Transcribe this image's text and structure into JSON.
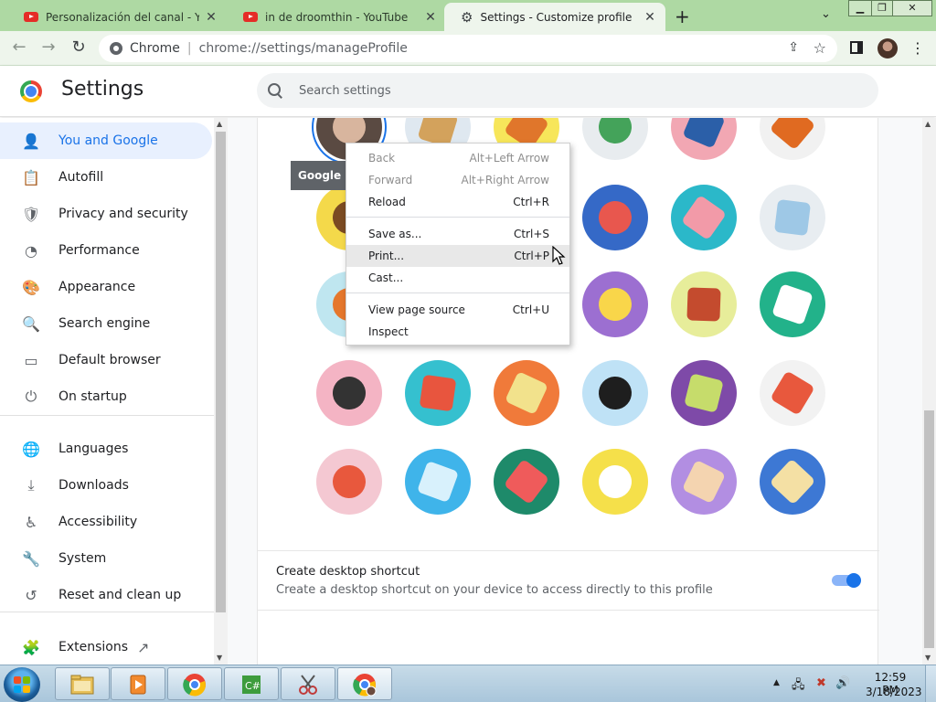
{
  "tabs": [
    {
      "title": "Personalización del canal - YouTube",
      "close": "✕",
      "icon": "youtube-icon"
    },
    {
      "title": "in de droomthin - YouTube",
      "close": "✕",
      "icon": "youtube-icon"
    },
    {
      "title": "Settings - Customize profile",
      "close": "✕",
      "icon": "settings-gear-icon"
    }
  ],
  "toolbar": {
    "back": "←",
    "forward": "→",
    "reload": "↻",
    "site_label": "Chrome",
    "separator": "|",
    "url": "chrome://settings/manageProfile",
    "share": "⇪",
    "star": "☆",
    "menu": "⋮",
    "new_tab": "+",
    "tab_search": "⌄"
  },
  "window_controls": {
    "minimize": "▁",
    "maximize": "❐",
    "close": "✕"
  },
  "settings": {
    "title": "Settings",
    "search_placeholder": "Search settings"
  },
  "sidebar": {
    "items": [
      {
        "label": "You and Google",
        "icon": "person-icon",
        "glyph": "👤",
        "active": true
      },
      {
        "label": "Autofill",
        "icon": "clipboard-icon",
        "glyph": "📋"
      },
      {
        "label": "Privacy and security",
        "icon": "shield-icon",
        "glyph": "🛡"
      },
      {
        "label": "Performance",
        "icon": "gauge-icon",
        "glyph": "◔"
      },
      {
        "label": "Appearance",
        "icon": "palette-icon",
        "glyph": "🎨"
      },
      {
        "label": "Search engine",
        "icon": "search-icon",
        "glyph": "🔍"
      },
      {
        "label": "Default browser",
        "icon": "browser-window-icon",
        "glyph": "▭"
      },
      {
        "label": "On startup",
        "icon": "power-icon",
        "glyph": "⏻"
      },
      {
        "label": "Languages",
        "icon": "globe-icon",
        "glyph": "🌐"
      },
      {
        "label": "Downloads",
        "icon": "download-icon",
        "glyph": "⤓"
      },
      {
        "label": "Accessibility",
        "icon": "accessibility-icon",
        "glyph": "♿"
      },
      {
        "label": "System",
        "icon": "wrench-icon",
        "glyph": "🔧"
      },
      {
        "label": "Reset and clean up",
        "icon": "history-icon",
        "glyph": "↺"
      },
      {
        "label": "Extensions",
        "icon": "puzzle-icon",
        "glyph": "🧩",
        "trailing": "↗"
      }
    ]
  },
  "avatars": [
    {
      "name": "current-photo",
      "bg": "#5a4a42",
      "fg": "#d8b59e",
      "selected": true
    },
    {
      "name": "origami-person",
      "bg": "#dfe8f0",
      "fg": "#d3a25c"
    },
    {
      "name": "origami-fox-yellow",
      "bg": "#f7e65a",
      "fg": "#e0762b"
    },
    {
      "name": "origami-dragon",
      "bg": "#e8ecef",
      "fg": "#44a35a"
    },
    {
      "name": "origami-elephant",
      "bg": "#f2a7b3",
      "fg": "#2b5fa8"
    },
    {
      "name": "origami-fox",
      "bg": "#f1f1f1",
      "fg": "#e06a21"
    },
    {
      "name": "origami-monkey",
      "bg": "#f4d94a",
      "fg": "#7b4b22"
    },
    {
      "name": "origami-panda",
      "bg": "#e4eef6",
      "fg": "#222222"
    },
    {
      "name": "origami-penguin",
      "bg": "#f3f3f3",
      "fg": "#1f1f1f"
    },
    {
      "name": "origami-butterfly",
      "bg": "#3569c7",
      "fg": "#e8574e"
    },
    {
      "name": "origami-rabbit",
      "bg": "#2bb8c9",
      "fg": "#f29aa8"
    },
    {
      "name": "origami-unicorn",
      "bg": "#e8edf1",
      "fg": "#9ec8e6"
    },
    {
      "name": "basketball",
      "bg": "#bfe6f0",
      "fg": "#e5772c"
    },
    {
      "name": "bike",
      "bg": "#f0a3b2",
      "fg": "#3c3c3c"
    },
    {
      "name": "bird",
      "bg": "#f7e06a",
      "fg": "#4d89d8"
    },
    {
      "name": "cheese",
      "bg": "#9c6fd1",
      "fg": "#f9d64a"
    },
    {
      "name": "football",
      "bg": "#e7ed9a",
      "fg": "#c44b2e"
    },
    {
      "name": "ramen",
      "bg": "#22b28a",
      "fg": "#ffffff"
    },
    {
      "name": "sunglasses",
      "bg": "#f4b4c4",
      "fg": "#333333"
    },
    {
      "name": "sushi",
      "bg": "#35c0cf",
      "fg": "#e8553e"
    },
    {
      "name": "tamagotchi",
      "bg": "#f07a3a",
      "fg": "#f2e28c"
    },
    {
      "name": "vinyl",
      "bg": "#bfe2f6",
      "fg": "#1e1e1e"
    },
    {
      "name": "avocado",
      "bg": "#7e4aa8",
      "fg": "#c6dc6b"
    },
    {
      "name": "cappuccino",
      "bg": "#f2f2f2",
      "fg": "#e8583d"
    },
    {
      "name": "ice-cream",
      "bg": "#f4c8d2",
      "fg": "#e8583d"
    },
    {
      "name": "ice-water",
      "bg": "#3fb4ea",
      "fg": "#d8f1fc"
    },
    {
      "name": "watermelon",
      "bg": "#1e8a6a",
      "fg": "#ef5b5b"
    },
    {
      "name": "onigiri",
      "bg": "#f5e04a",
      "fg": "#ffffff"
    },
    {
      "name": "pizza",
      "bg": "#b28ee2",
      "fg": "#f4d4b0"
    },
    {
      "name": "sandwich",
      "bg": "#3d78d4",
      "fg": "#f4e0a4"
    }
  ],
  "tooltip": "Google Profile photo",
  "context_menu": [
    {
      "label": "Back",
      "shortcut": "Alt+Left Arrow",
      "disabled": true
    },
    {
      "label": "Forward",
      "shortcut": "Alt+Right Arrow",
      "disabled": true
    },
    {
      "label": "Reload",
      "shortcut": "Ctrl+R"
    },
    {
      "label": "Save as...",
      "shortcut": "Ctrl+S"
    },
    {
      "label": "Print...",
      "shortcut": "Ctrl+P",
      "hover": true
    },
    {
      "label": "Cast...",
      "shortcut": ""
    },
    {
      "label": "View page source",
      "shortcut": "Ctrl+U"
    },
    {
      "label": "Inspect",
      "shortcut": ""
    }
  ],
  "shortcut": {
    "title": "Create desktop shortcut",
    "description": "Create a desktop shortcut on your device to access directly to this profile",
    "enabled": true
  },
  "taskbar": {
    "apps": [
      "explorer",
      "media-player",
      "chrome",
      "csharp-editor",
      "snipping-tool",
      "chrome-profile"
    ],
    "tray_arrow": "▲",
    "tray_icons": [
      "🖧",
      "✖",
      "🔊"
    ],
    "time": "12:59 PM",
    "date": "3/18/2023"
  },
  "colors": {
    "tabstrip": "#aed9a3",
    "toolbar": "#eef5ec",
    "accent": "#1a73e8",
    "active_nav_bg": "#e8f0fe"
  }
}
